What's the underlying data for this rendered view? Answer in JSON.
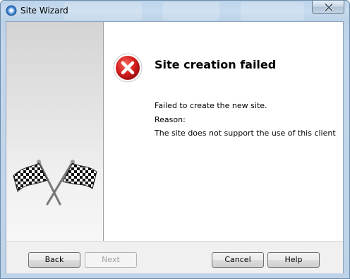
{
  "window": {
    "title": "Site Wizard",
    "icons": {
      "app": "wizard-app-icon",
      "close": "close-icon",
      "error": "error-icon",
      "side_image": "checkered-flags-icon"
    }
  },
  "content": {
    "heading": "Site creation failed",
    "message": "Failed to create the new site.",
    "reason_label": "Reason:",
    "reason_text": "The site does not support the use of this client"
  },
  "buttons": {
    "back": "Back",
    "next": "Next",
    "cancel": "Cancel",
    "help": "Help"
  },
  "colors": {
    "error_red": "#d7201f",
    "title_glass": "#c3d7ec"
  }
}
